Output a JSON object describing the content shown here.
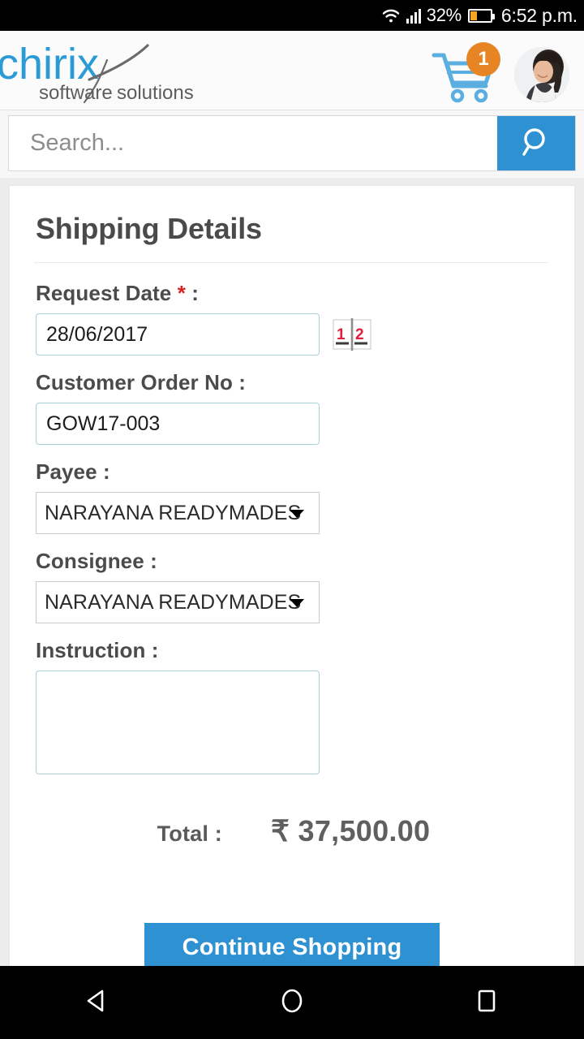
{
  "status_bar": {
    "wifi_icon": "wifi-icon",
    "signal_icon": "cellular-signal-icon",
    "battery_percent": "32%",
    "battery_icon": "battery-icon",
    "time": "6:52 p.m."
  },
  "header": {
    "logo_primary": "chirix",
    "logo_tagline": "software solutions",
    "cart_icon": "shopping-cart-icon",
    "cart_badge_count": "1",
    "avatar": "user-avatar"
  },
  "search": {
    "placeholder": "Search...",
    "value": "",
    "button_icon": "search-icon"
  },
  "form": {
    "title": "Shipping Details",
    "request_date": {
      "label": "Request Date",
      "required_mark": "*",
      "colon": ":",
      "value": "28/06/2017",
      "picker_icon": "calendar-date-picker-icon"
    },
    "customer_order_no": {
      "label": "Customer Order No",
      "colon": ":",
      "value": "GOW17-003"
    },
    "payee": {
      "label": "Payee",
      "colon": ":",
      "value": "NARAYANA READYMADES"
    },
    "consignee": {
      "label": "Consignee",
      "colon": ":",
      "value": "NARAYANA READYMADES"
    },
    "instruction": {
      "label": "Instruction",
      "colon": ":",
      "value": ""
    },
    "total": {
      "label": "Total :",
      "value": "₹ 37,500.00"
    },
    "continue_button": "Continue Shopping"
  },
  "nav_bar": {
    "back": "back-icon",
    "home": "home-icon",
    "recents": "recents-icon"
  },
  "colors": {
    "accent_blue": "#2e92d2",
    "logo_blue": "#2a9bd4",
    "badge_orange": "#e78525",
    "required_red": "#e02020",
    "page_background": "#ececec",
    "battery_orange": "#f5a623"
  }
}
